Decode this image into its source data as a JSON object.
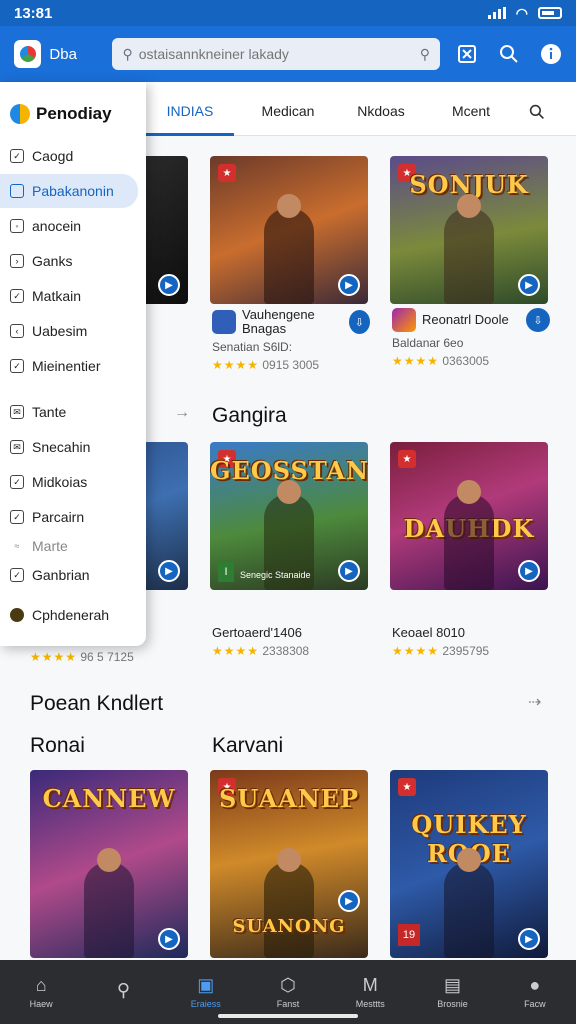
{
  "status": {
    "time": "13:81"
  },
  "appbar": {
    "brand": "Dba",
    "search_placeholder": "ostaisannkneiner lakady"
  },
  "tabs": [
    "INDIAS",
    "Medican",
    "Nkdoas",
    "Mcent"
  ],
  "drawer": {
    "title": "Penodiay",
    "items": [
      {
        "label": "Caogd",
        "selected": false
      },
      {
        "label": "Pabakanonin",
        "selected": true
      },
      {
        "label": "anocein",
        "selected": false
      },
      {
        "label": "Ganks",
        "selected": false
      },
      {
        "label": "Matkain",
        "selected": false
      },
      {
        "label": "Uabesim",
        "selected": false
      },
      {
        "label": "Mieinentier",
        "selected": false
      },
      {
        "label": "Tante",
        "selected": false
      },
      {
        "label": "Snecahin",
        "selected": false
      },
      {
        "label": "Midkoias",
        "selected": false
      },
      {
        "label": "Parcairn",
        "selected": false
      },
      {
        "label": "Marte",
        "selected": false
      },
      {
        "label": "Ganbrian",
        "selected": false
      },
      {
        "label": "Cphdenerah",
        "selected": false
      }
    ]
  },
  "row1": [
    {
      "art": "",
      "name": "",
      "sub": "",
      "rating": ""
    },
    {
      "art": "",
      "name": "Vauhengene Bnagas",
      "sub": "Senatian S6lD:",
      "rating": "0915 3005"
    },
    {
      "art": "SONJUK",
      "name": "Reonatrl Doole",
      "sub": "Baldanar 6eo",
      "rating": "0363005"
    }
  ],
  "section2": {
    "title": "Gangira"
  },
  "row2": [
    {
      "art": "",
      "name": "",
      "sub": "",
      "rating": "96 5 7125"
    },
    {
      "art": "GEOSSTAN",
      "name": "Gertoaerd'1406",
      "sub": "",
      "rating": "2338308",
      "sub_tag": "Senegic Stanaide"
    },
    {
      "art": "DAUHDK",
      "name": "Keoael 8010",
      "sub": "",
      "rating": "2395795"
    }
  ],
  "section3": {
    "title": "Poean Kndlert"
  },
  "row3_labels": {
    "left": "Ronai",
    "right": "Karvani"
  },
  "row3": [
    {
      "art": "CANNEW"
    },
    {
      "art": "SUAANEP",
      "art2": "SUANONG"
    },
    {
      "art": "QUIKEY ROOE"
    }
  ],
  "bottomnav": [
    {
      "label": "Haew",
      "icon": "home-icon"
    },
    {
      "label": "",
      "icon": "search-icon"
    },
    {
      "label": "Eraiess",
      "icon": "library-icon"
    },
    {
      "label": "Fanst",
      "icon": "hexagon-icon"
    },
    {
      "label": "Mesttts",
      "icon": "m-icon"
    },
    {
      "label": "Brosnie",
      "icon": "store-icon"
    },
    {
      "label": "Facw",
      "icon": "profile-icon"
    }
  ],
  "colors": {
    "primary": "#1a6fd8",
    "statusbar": "#1565c0",
    "accent": "#1565c0",
    "star": "#f4b400",
    "nav_bg": "#2b2d31"
  }
}
